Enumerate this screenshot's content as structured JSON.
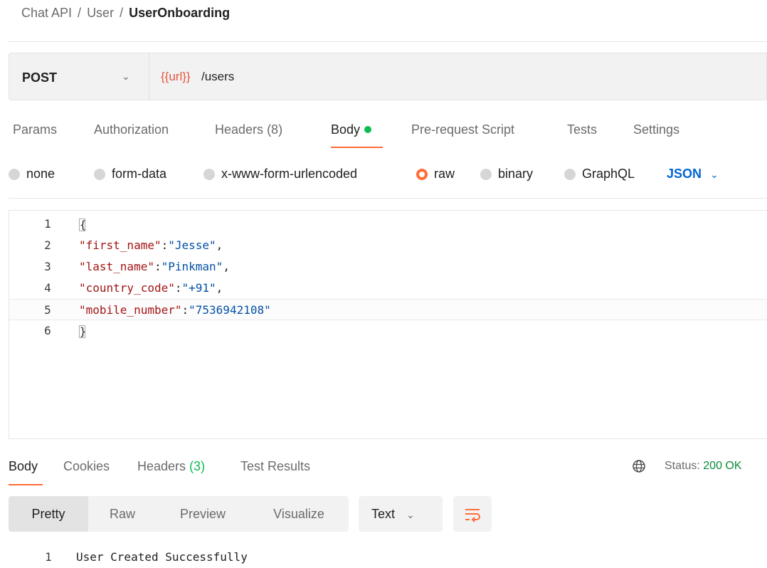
{
  "breadcrumb": {
    "items": [
      "Chat API",
      "User"
    ],
    "separator": "/",
    "current": "UserOnboarding"
  },
  "request": {
    "method": "POST",
    "url_variable": "{{url}}",
    "url_path": "/users"
  },
  "tabs": [
    {
      "label": "Params"
    },
    {
      "label": "Authorization"
    },
    {
      "label": "Headers",
      "count": "(8)"
    },
    {
      "label": "Body",
      "active": true,
      "indicator": "green-dot"
    },
    {
      "label": "Pre-request Script"
    },
    {
      "label": "Tests"
    },
    {
      "label": "Settings"
    }
  ],
  "body_types": [
    "none",
    "form-data",
    "x-www-form-urlencoded",
    "raw",
    "binary",
    "GraphQL"
  ],
  "body_type_selected": "raw",
  "language": "JSON",
  "editor": {
    "line_numbers": [
      "1",
      "2",
      "3",
      "4",
      "5",
      "6"
    ],
    "open_brace": "{",
    "close_brace": "}",
    "fields": [
      {
        "key": "\"first_name\"",
        "value": "\"Jesse\"",
        "trail": ","
      },
      {
        "key": "\"last_name\"",
        "value": "\"Pinkman\"",
        "trail": ","
      },
      {
        "key": "\"country_code\"",
        "value": "\"+91\"",
        "trail": ","
      },
      {
        "key": "\"mobile_number\"",
        "value": "\"7536942108\"",
        "trail": ""
      }
    ],
    "colon": ":"
  },
  "response": {
    "tabs": [
      {
        "label": "Body",
        "active": true
      },
      {
        "label": "Cookies"
      },
      {
        "label": "Headers",
        "count": "(3)"
      },
      {
        "label": "Test Results"
      }
    ],
    "status_label": "Status:",
    "status_code": "200 OK",
    "view_modes": [
      "Pretty",
      "Raw",
      "Preview",
      "Visualize"
    ],
    "view_selected": "Pretty",
    "format": "Text",
    "line_number": "1",
    "body_text": "User Created Successfully"
  },
  "colors": {
    "accent": "#ff6c37",
    "success": "#0cbb52",
    "link": "#0265d2",
    "url_variable": "#e4563d"
  },
  "icons": [
    "chevron-down-icon",
    "globe-icon",
    "wrap-lines-icon"
  ]
}
